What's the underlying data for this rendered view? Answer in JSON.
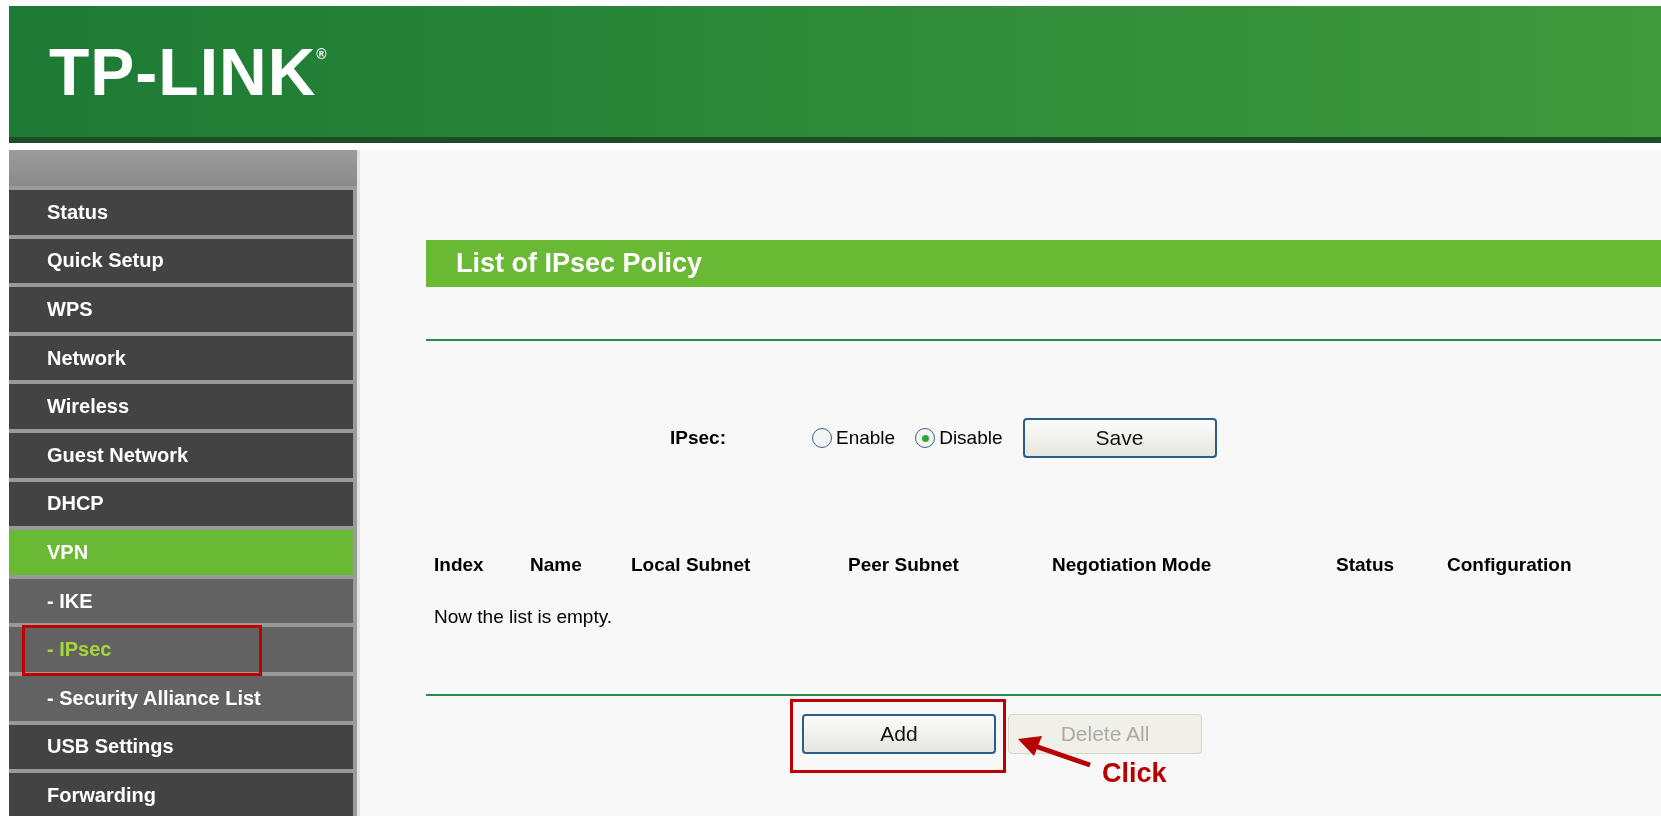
{
  "header": {
    "logo": "TP-LINK$^{®}$"
  },
  "sidebar": {
    "items": [
      {
        "label": "Status",
        "selected": false,
        "highlighted": false
      },
      {
        "label": "Quick Setup",
        "selected": false,
        "highlighted": false
      },
      {
        "label": "WPS",
        "selected": false,
        "highlighted": false
      },
      {
        "label": "Network",
        "selected": false,
        "highlighted": false
      },
      {
        "label": "Wireless",
        "selected": false,
        "highlighted": false
      },
      {
        "label": "Guest Network",
        "selected": false,
        "highlighted": false
      },
      {
        "label": "DHCP",
        "selected": false,
        "highlighted": false
      },
      {
        "label": "VPN",
        "selected": true,
        "highlighted": false,
        "children": [
          {
            "label": "- IKE",
            "selected": false,
            "highlighted": false
          },
          {
            "label": "- IPsec",
            "selected": true,
            "highlighted": true
          },
          {
            "label": "- Security Alliance List",
            "selected": false,
            "highlighted": false
          }
        ]
      },
      {
        "label": "USB Settings",
        "selected": false,
        "highlighted": false
      },
      {
        "label": "Forwarding",
        "selected": false,
        "highlighted": false
      }
    ]
  },
  "page": {
    "title": "List of IPsec Policy",
    "ipsec": {
      "label": "IPsec:",
      "options": [
        {
          "label": "Enable",
          "selected": false
        },
        {
          "label": "Disable",
          "selected": true
        }
      ],
      "save_button": "Save"
    },
    "table": {
      "columns": [
        "Index",
        "Name",
        "Local Subnet",
        "Peer Subnet",
        "Negotiation Mode",
        "Status",
        "Configuration"
      ],
      "empty_message": "Now the list is empty."
    },
    "buttons": [
      {
        "label": "Add",
        "disabled": false,
        "highlighted": true
      },
      {
        "label": "Delete All",
        "disabled": true,
        "highlighted": false
      }
    ],
    "callout": {
      "text": "Click"
    }
  }
}
